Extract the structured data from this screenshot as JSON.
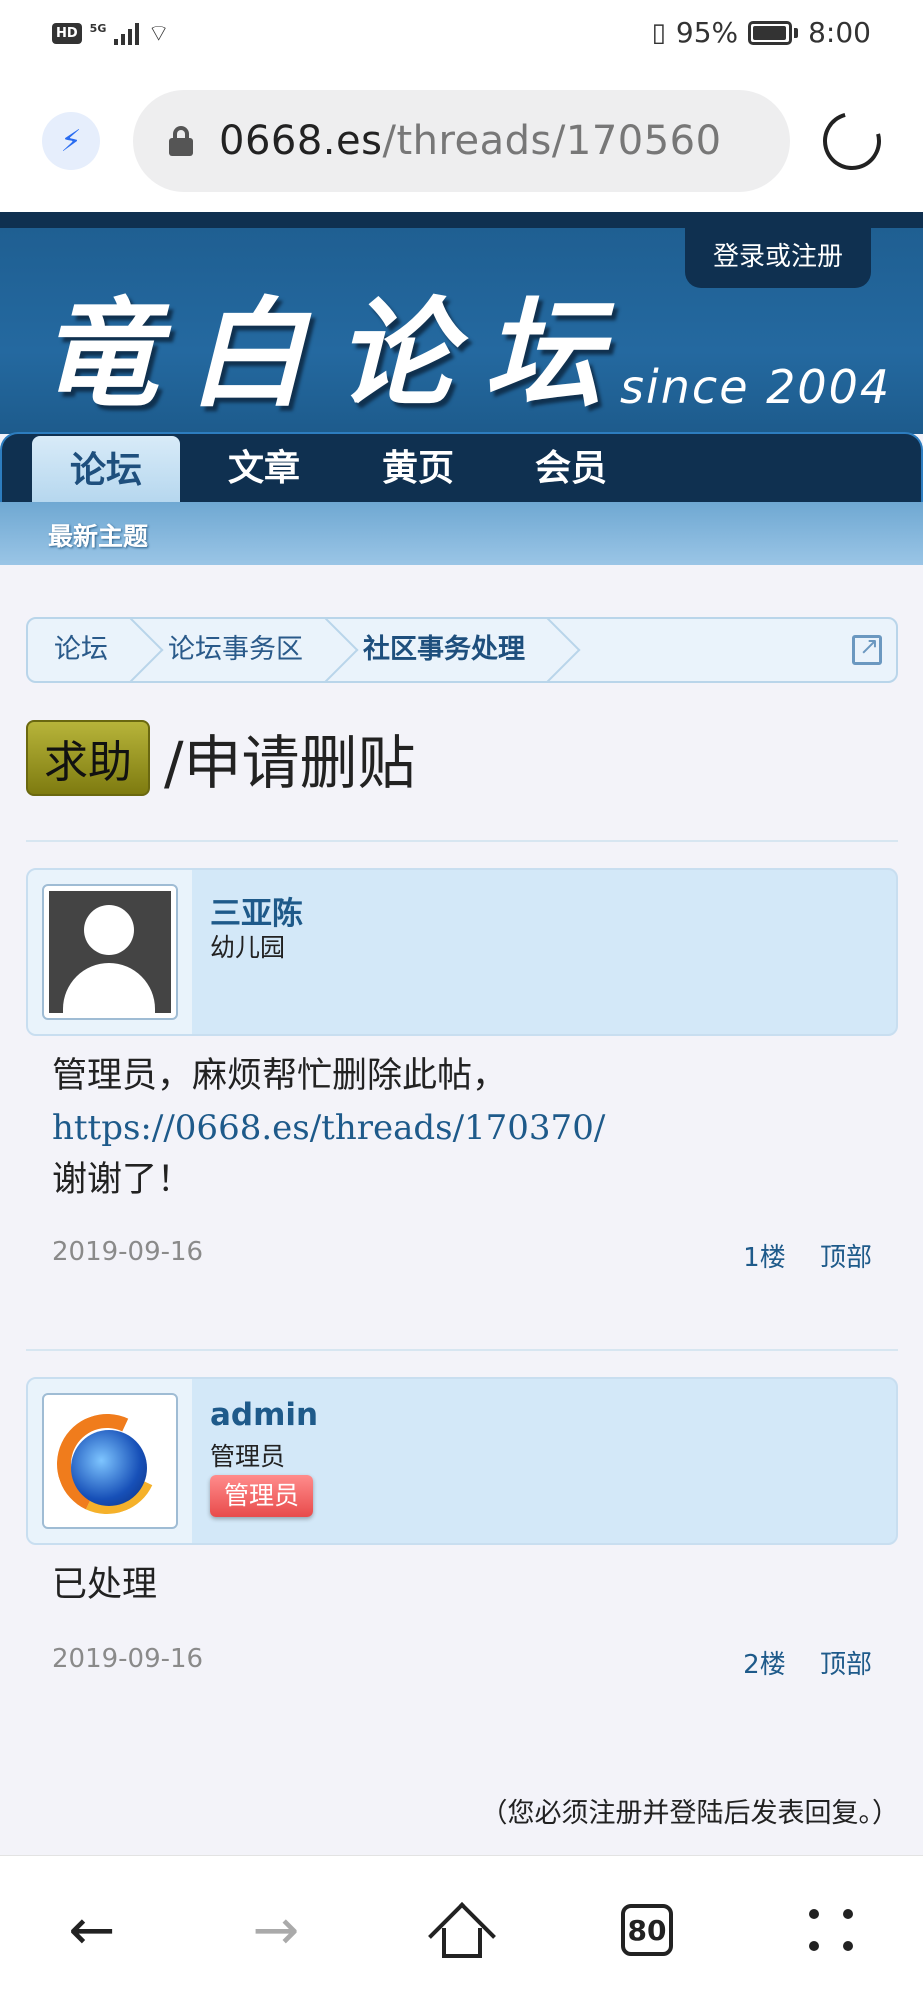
{
  "status_bar": {
    "hd": "HD",
    "network": "5G",
    "battery": "95%",
    "time": "8:00"
  },
  "browser": {
    "url_domain": "0668.es",
    "url_path": "/threads/170560"
  },
  "site": {
    "logo_text": "竜白论坛",
    "since_text": "since 2004",
    "login_label": "登录或注册",
    "nav": [
      "论坛",
      "文章",
      "黄页",
      "会员"
    ],
    "subnav": "最新主题"
  },
  "breadcrumb": [
    "论坛",
    "论坛事务区",
    "社区事务处理"
  ],
  "thread": {
    "prefix": "求助",
    "title": "/申请删贴"
  },
  "posts": [
    {
      "username": "三亚陈",
      "user_title": "幼儿园",
      "lines": [
        "管理员，麻烦帮忙删除此帖，",
        "https://0668.es/threads/170370/",
        "谢谢了！"
      ],
      "date": "2019-09-16",
      "floor": "1楼",
      "top": "顶部"
    },
    {
      "username": "admin",
      "user_title": "管理员",
      "badge": "管理员",
      "lines": [
        "已处理"
      ],
      "date": "2019-09-16",
      "floor": "2楼",
      "top": "顶部"
    }
  ],
  "footer_note": "（您必须注册并登陆后发表回复。）",
  "bottom_nav": {
    "tabs_count": "80"
  }
}
